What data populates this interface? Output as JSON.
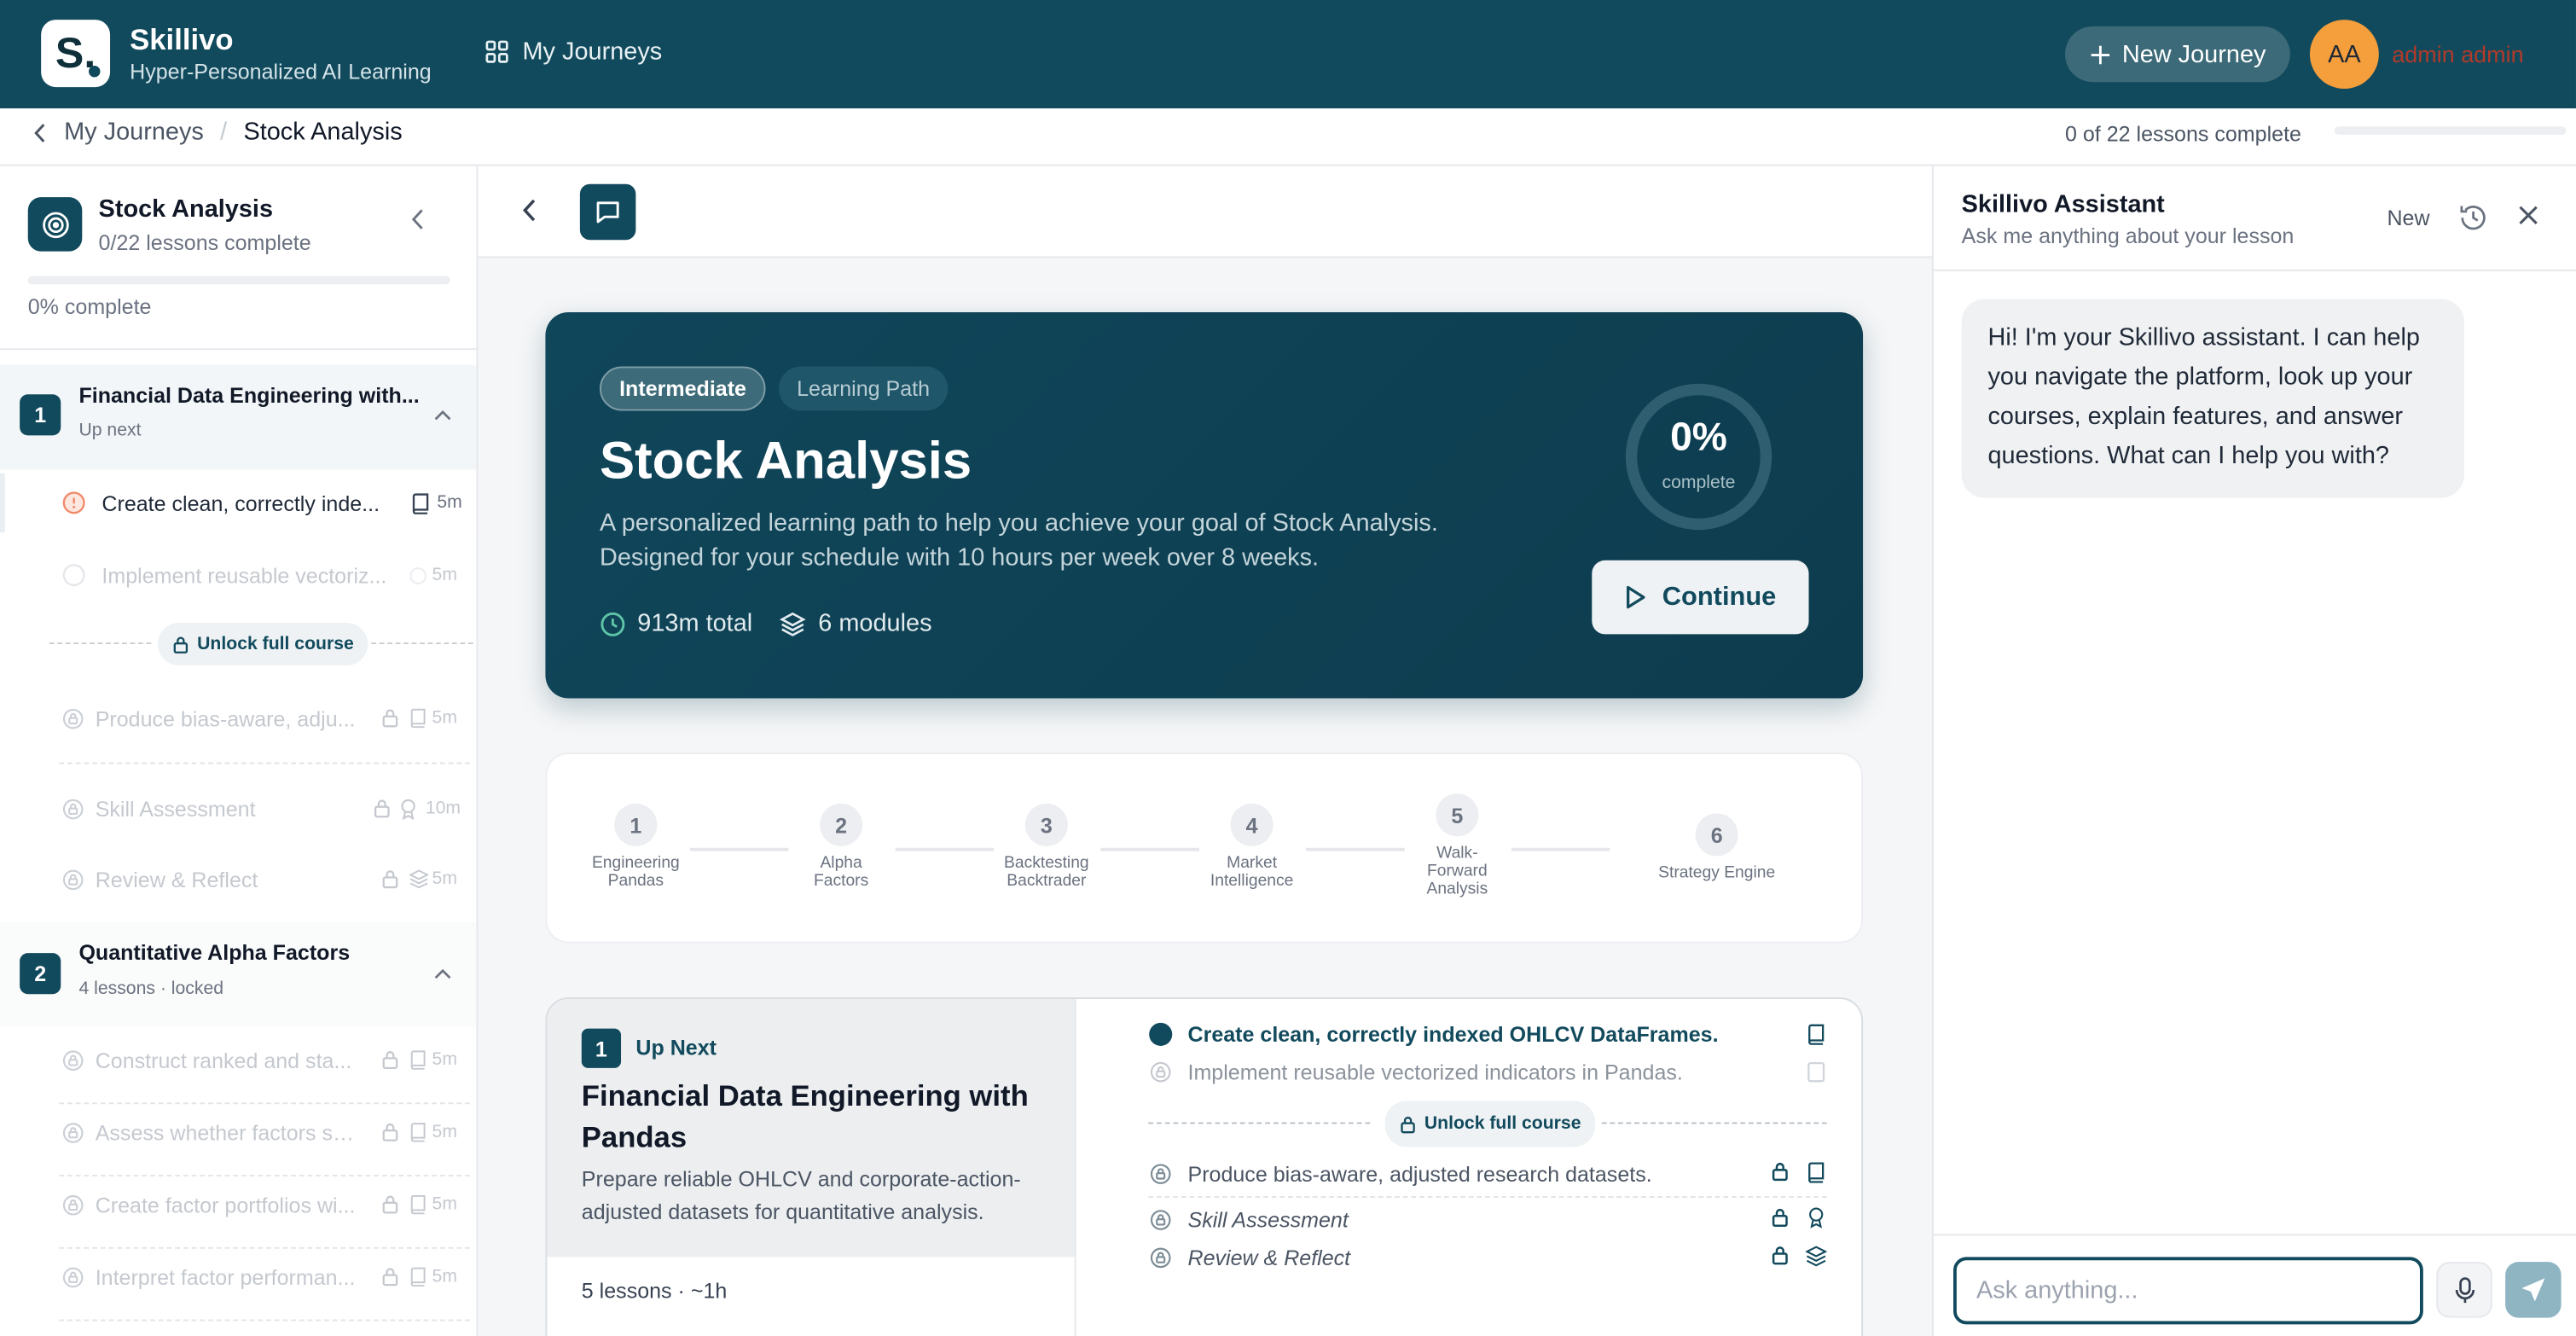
{
  "colors": {
    "brand": "#124a5d",
    "avatar": "#f59e3c",
    "warning": "#f08a6a"
  },
  "app": {
    "logo_letter": "S.",
    "name": "Skillivo",
    "tagline": "Hyper-Personalized AI Learning"
  },
  "nav": {
    "my_journeys": "My Journeys",
    "new_journey": "New Journey",
    "avatar_initials": "AA",
    "username": "admin admin"
  },
  "breadcrumb": {
    "parent": "My Journeys",
    "separator": "/",
    "current": "Stock Analysis",
    "progress_text": "0 of 22 lessons complete",
    "progress_fraction": 0
  },
  "sidebar": {
    "title": "Stock Analysis",
    "subtitle": "0/22 lessons complete",
    "percent_label": "0% complete",
    "progress_fraction": 0,
    "unlock_label": "Unlock full course",
    "modules": [
      {
        "num": "1",
        "title": "Financial Data Engineering with...",
        "subtitle": "Up next",
        "lessons": [
          {
            "title": "Create clean, correctly inde...",
            "duration": "5m",
            "icon": "book-icon",
            "state": "current"
          },
          {
            "title": "Implement reusable vectoriz...",
            "duration": "5m",
            "icon": "book-icon",
            "state": "faded"
          },
          {
            "title": "Produce bias-aware, adju...",
            "duration": "5m",
            "icon": "book-icon",
            "state": "locked"
          },
          {
            "title": "Skill Assessment",
            "duration": "10m",
            "icon": "award-icon",
            "state": "locked"
          },
          {
            "title": "Review & Reflect",
            "duration": "5m",
            "icon": "layers-icon",
            "state": "locked"
          }
        ]
      },
      {
        "num": "2",
        "title": "Quantitative Alpha Factors",
        "subtitle": "4 lessons · locked",
        "lessons": [
          {
            "title": "Construct ranked and sta...",
            "duration": "5m",
            "icon": "book-icon",
            "state": "locked"
          },
          {
            "title": "Assess whether factors sh...",
            "duration": "5m",
            "icon": "book-icon",
            "state": "locked"
          },
          {
            "title": "Create factor portfolios wi...",
            "duration": "5m",
            "icon": "book-icon",
            "state": "locked"
          },
          {
            "title": "Interpret factor performan...",
            "duration": "5m",
            "icon": "book-icon",
            "state": "locked"
          }
        ]
      }
    ]
  },
  "hero": {
    "badge_level": "Intermediate",
    "badge_type": "Learning Path",
    "title": "Stock Analysis",
    "description": "A personalized learning path to help you achieve your goal of Stock Analysis. Designed for your schedule with 10 hours per week over 8 weeks.",
    "total_time": "913m total",
    "modules_count": "6 modules",
    "percent": "0%",
    "percent_label": "complete",
    "continue_label": "Continue"
  },
  "steps": [
    {
      "num": "1",
      "label": "Engineering Pandas"
    },
    {
      "num": "2",
      "label": "Alpha Factors"
    },
    {
      "num": "3",
      "label": "Backtesting Backtrader"
    },
    {
      "num": "4",
      "label": "Market Intelligence"
    },
    {
      "num": "5",
      "label": "Walk-Forward Analysis"
    },
    {
      "num": "6",
      "label": "Strategy Engine"
    }
  ],
  "module_card": {
    "num": "1",
    "status": "Up Next",
    "title": "Financial Data Engineering with Pandas",
    "description": "Prepare reliable OHLCV and corporate-action-adjusted datasets for quantitative analysis.",
    "meta": "5 lessons · ~1h",
    "unlock_label": "Unlock full course",
    "lessons": [
      {
        "title": "Create clean, correctly indexed OHLCV DataFrames."
      },
      {
        "title": "Implement reusable vectorized indicators in Pandas."
      },
      {
        "title": "Produce bias-aware, adjusted research datasets."
      },
      {
        "title": "Skill Assessment"
      },
      {
        "title": "Review & Reflect"
      }
    ]
  },
  "assistant": {
    "title": "Skillivo Assistant",
    "subtitle": "Ask me anything about your lesson",
    "new_label": "New",
    "message": "Hi! I'm your Skillivo assistant. I can help you navigate the platform, look up your courses, explain features, and answer questions. What can I help you with?",
    "input_placeholder": "Ask anything..."
  }
}
